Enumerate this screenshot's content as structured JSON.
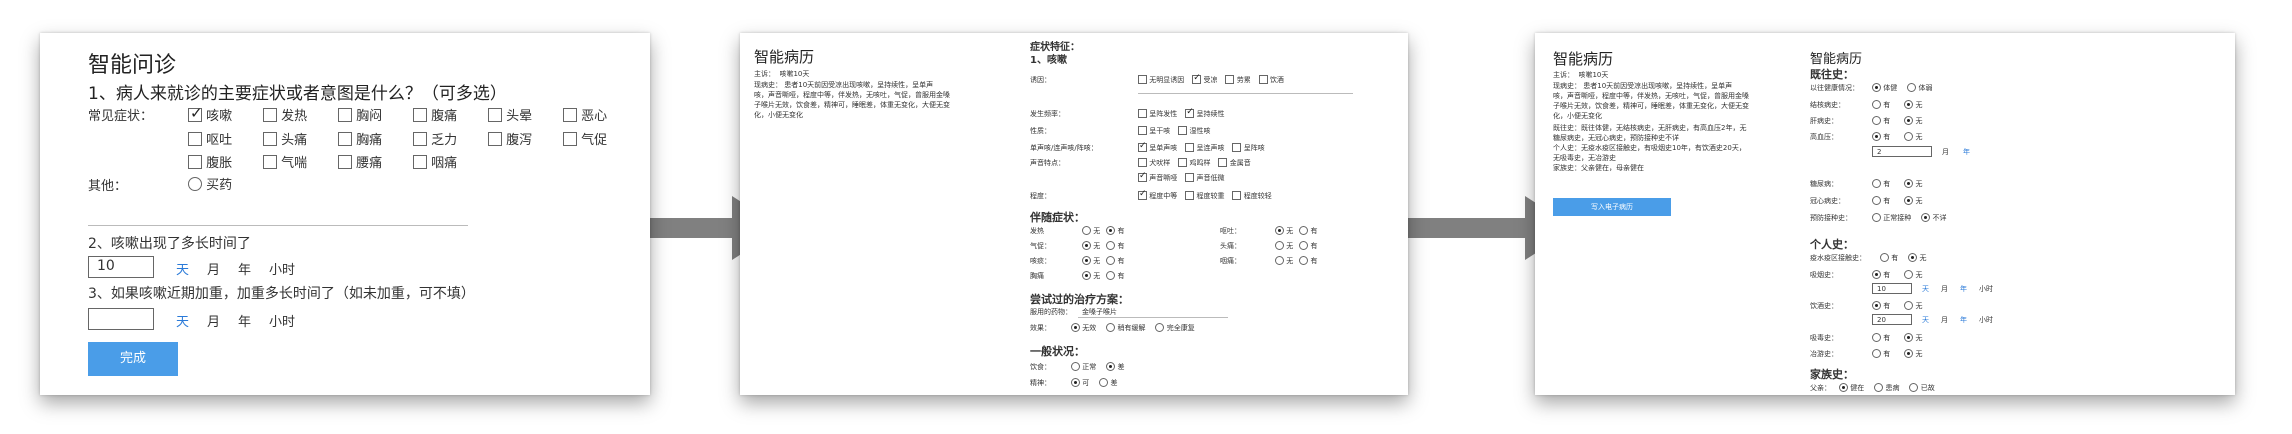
{
  "panel1": {
    "title": "智能问诊",
    "q1": "1、病人来就诊的主要症状或者意图是什么？（可多选）",
    "common_label": "常见症状：",
    "symptoms_row1": [
      {
        "label": "咳嗽",
        "checked": true
      },
      {
        "label": "发热",
        "checked": false
      },
      {
        "label": "胸闷",
        "checked": false
      },
      {
        "label": "腹痛",
        "checked": false
      },
      {
        "label": "头晕",
        "checked": false
      },
      {
        "label": "恶心",
        "checked": false
      }
    ],
    "symptoms_row2": [
      {
        "label": "呕吐",
        "checked": false
      },
      {
        "label": "头痛",
        "checked": false
      },
      {
        "label": "胸痛",
        "checked": false
      },
      {
        "label": "乏力",
        "checked": false
      },
      {
        "label": "腹泻",
        "checked": false
      },
      {
        "label": "气促",
        "checked": false
      }
    ],
    "symptoms_row3": [
      {
        "label": "腹胀",
        "checked": false
      },
      {
        "label": "气喘",
        "checked": false
      },
      {
        "label": "腰痛",
        "checked": false
      },
      {
        "label": "咽痛",
        "checked": false
      }
    ],
    "other_label": "其他：",
    "other_option": "买药",
    "q2": "2、咳嗽出现了多长时间了",
    "q2_value": "10",
    "units": [
      "天",
      "月",
      "年",
      "小时"
    ],
    "q3": "3、如果咳嗽近期加重，加重多长时间了（如未加重，可不填）",
    "q3_value": "",
    "done_button": "完成"
  },
  "panel2": {
    "title": "智能病历",
    "chief_label": "主诉：",
    "chief_value": "咳嗽10天",
    "history_label": "现病史：",
    "history_lines": [
      "患者10天前因受凉出现咳嗽，呈持续性，呈单声",
      "咳，声音嘶哑，程度中等，伴发热，无咳吐，气促，曾服用金嗓",
      "子喉片无效，饮食差，精神可，睡眠差，体重无变化，大便无变",
      "化，小便无变化"
    ],
    "features_title": "症状特征：",
    "cough_title": "1、咳嗽",
    "f_rows": [
      {
        "label": "诱因：",
        "opts": [
          {
            "t": "无明显诱因",
            "on": false
          },
          {
            "t": "受凉",
            "on": true
          },
          {
            "t": "劳累",
            "on": false
          },
          {
            "t": "饮酒",
            "on": false
          }
        ]
      },
      {
        "label": "发生频率：",
        "opts": [
          {
            "t": "呈阵发性",
            "on": false
          },
          {
            "t": "呈持续性",
            "on": true
          }
        ]
      },
      {
        "label": "性质：",
        "opts": [
          {
            "t": "呈干咳",
            "on": false
          },
          {
            "t": "湿性咳",
            "on": false
          }
        ]
      },
      {
        "label": "单声咳/连声咳/阵咳：",
        "opts": [
          {
            "t": "呈单声咳",
            "on": true
          },
          {
            "t": "呈连声咳",
            "on": false
          },
          {
            "t": "呈阵咳",
            "on": false
          }
        ]
      },
      {
        "label": "声音特点：",
        "opts": [
          {
            "t": "犬吠样",
            "on": false
          },
          {
            "t": "鸡鸣样",
            "on": false
          },
          {
            "t": "金属音",
            "on": false
          }
        ]
      },
      {
        "label": "",
        "opts": [
          {
            "t": "声音嘶哑",
            "on": true
          },
          {
            "t": "声音低微",
            "on": false
          }
        ]
      },
      {
        "label": "程度：",
        "opts": [
          {
            "t": "程度中等",
            "on": true
          },
          {
            "t": "程度较重",
            "on": false
          },
          {
            "t": "程度较轻",
            "on": false
          }
        ]
      }
    ],
    "accompany_title": "伴随症状：",
    "accompany_left": [
      {
        "label": "发热",
        "yes": true
      },
      {
        "label": "气促：",
        "yes": false,
        "no_first": true
      },
      {
        "label": "咳痰：",
        "yes": false
      },
      {
        "label": "胸痛",
        "yes": false
      }
    ],
    "accompany_right": [
      {
        "label": "呕吐：",
        "no": true
      },
      {
        "label": "头痛：",
        "no": false
      },
      {
        "label": "咽痛：",
        "no": false
      }
    ],
    "yn": [
      "无",
      "有"
    ],
    "tried_title": "尝试过的治疗方案：",
    "used_label": "服用的药物：",
    "used_value": "金嗓子喉片",
    "effect_label": "效果：",
    "effect_opts": [
      {
        "t": "无效",
        "on": true
      },
      {
        "t": "稍有缓解",
        "on": false
      },
      {
        "t": "完全康复",
        "on": false
      }
    ],
    "general_title": "一般状况：",
    "diet_label": "饮食：",
    "diet_opts": [
      {
        "t": "正常",
        "on": false
      },
      {
        "t": "差",
        "on": true
      }
    ],
    "spirit_label": "精神：",
    "spirit_opts": [
      {
        "t": "可",
        "on": true
      },
      {
        "t": "差",
        "on": false
      }
    ]
  },
  "panel3": {
    "title": "智能病历",
    "chief_label": "主诉：",
    "chief_value": "咳嗽10天",
    "history_label": "现病史：",
    "history_lines": [
      "患者10天前因受凉出现咳嗽，呈持续性，呈单声",
      "咳，声音嘶哑，程度中等，伴发热，无咳吐，气促，曾服用金嗓",
      "子喉片无效，饮食差，精神可，睡眠差，体重无变化，大便无变",
      "化，小便无变化"
    ],
    "past_line1": "既往史：既往体健，无结核病史，无肝病史，有高血压2年，无",
    "past_line2": "糖尿病史，无冠心病史，预防接种史不详",
    "personal_line": "个人史：无疫水疫区接触史，有吸烟史10年，有饮酒史20天，",
    "personal_line2": "无吸毒史，无冶游史",
    "family_line": "家族史：父亲健在，母亲健在",
    "write_button": "写入电子病历",
    "past_title": "既往史：",
    "health_label": "以往健康情况：",
    "health_opts": [
      {
        "t": "体健",
        "on": true
      },
      {
        "t": "体弱",
        "on": false
      }
    ],
    "past_rows": [
      {
        "label": "结核病史：",
        "yes": false
      },
      {
        "label": "肝病史：",
        "yes": false
      },
      {
        "label": "高血压：",
        "yes": true
      },
      {
        "label": "糖尿病：",
        "yes": false
      },
      {
        "label": "冠心病史：",
        "yes": false
      }
    ],
    "bp_value": "2",
    "bp_units": [
      "月",
      "年"
    ],
    "vacc_label": "预防接种史：",
    "vacc_opts": [
      {
        "t": "正常接种",
        "on": false
      },
      {
        "t": "不详",
        "on": true
      }
    ],
    "personal_title": "个人史：",
    "water_label": "疫水疫区接触史：",
    "smoke_label": "吸烟史：",
    "smoke_value": "10",
    "drink_label": "饮酒史：",
    "drink_value": "20",
    "drug_label": "吸毒史：",
    "wander_label": "冶游史：",
    "time_units": [
      "天",
      "月",
      "年",
      "小时"
    ],
    "family_title": "家族史：",
    "father_label": "父亲：",
    "father_opts": [
      {
        "t": "健在",
        "on": true
      },
      {
        "t": "患病",
        "on": false
      },
      {
        "t": "已故",
        "on": false
      }
    ],
    "yn": [
      "有",
      "无"
    ]
  }
}
